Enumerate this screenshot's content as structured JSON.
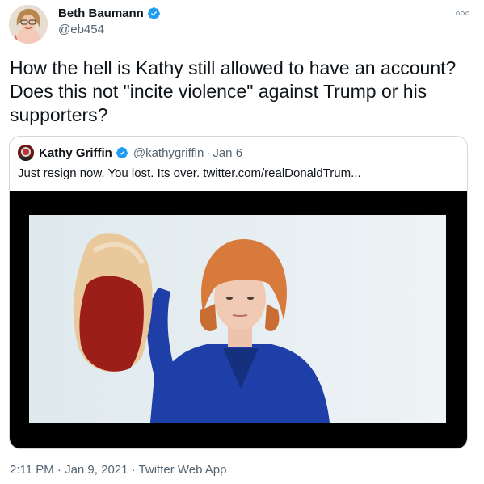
{
  "author": {
    "display_name": "Beth Baumann",
    "handle": "@eb454",
    "verified": true,
    "avatar_icon": "user-avatar-photo"
  },
  "tweet": {
    "text": "How the hell is Kathy still allowed to have an account? Does this not \"incite violence\" against Trump or his supporters?"
  },
  "more_icon": "more-options-icon",
  "quoted_tweet": {
    "display_name": "Kathy Griffin",
    "handle": "@kathygriffin",
    "separator": "·",
    "date": "Jan 6",
    "text": "Just resign now. You lost. Its over.  twitter.com/realDonaldTrum...",
    "verified": true,
    "media_icon": "photo-image"
  },
  "footer": {
    "meta": "2:11 PM · Jan 9, 2021 · Twitter Web App"
  },
  "colors": {
    "verified_badge": "#1d9bf0",
    "secondary_text": "#536471",
    "border": "#cfd9de"
  }
}
